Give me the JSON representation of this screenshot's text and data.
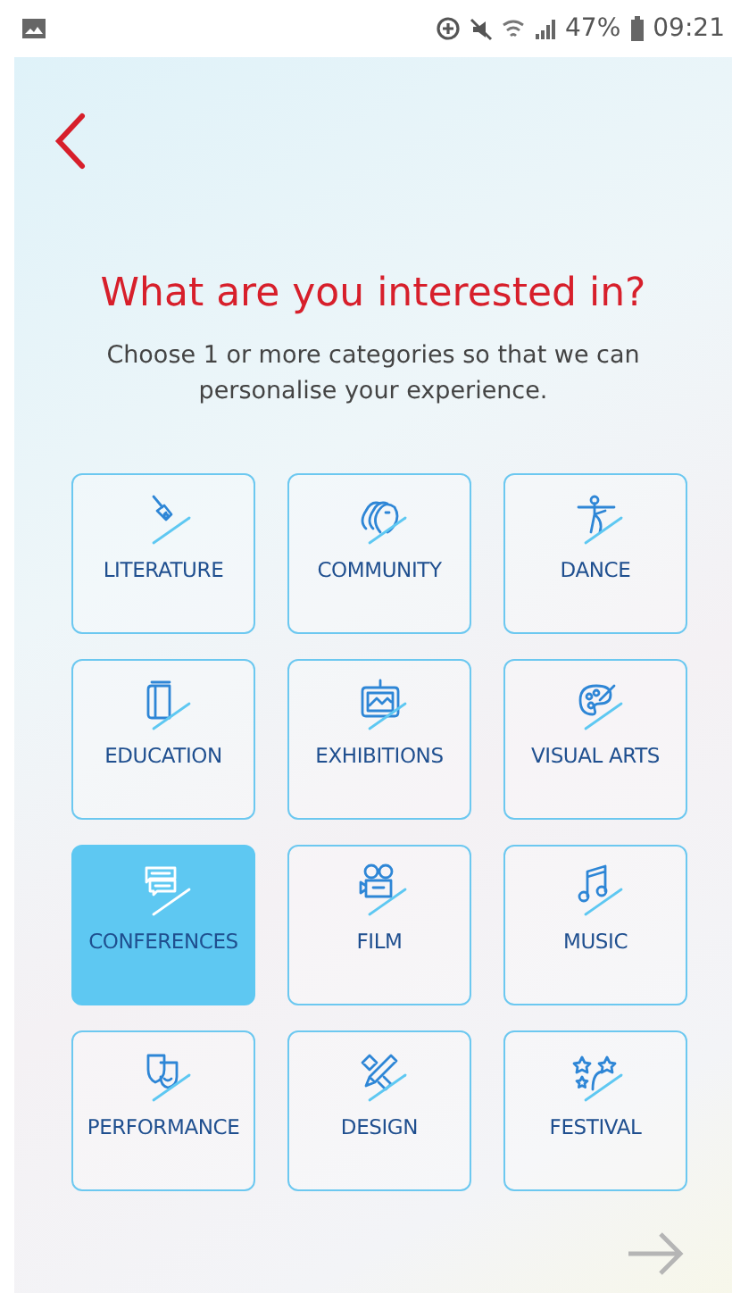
{
  "status_bar": {
    "battery": "47%",
    "time": "09:21"
  },
  "title": "What are you interested in?",
  "subtitle": "Choose 1 or more categories so that we can personalise your experience.",
  "categories": [
    {
      "label": "LITERATURE",
      "selected": false
    },
    {
      "label": "COMMUNITY",
      "selected": false
    },
    {
      "label": "DANCE",
      "selected": false
    },
    {
      "label": "EDUCATION",
      "selected": false
    },
    {
      "label": "EXHIBITIONS",
      "selected": false
    },
    {
      "label": "VISUAL ARTS",
      "selected": false
    },
    {
      "label": "CONFERENCES",
      "selected": true
    },
    {
      "label": "FILM",
      "selected": false
    },
    {
      "label": "MUSIC",
      "selected": false
    },
    {
      "label": "PERFORMANCE",
      "selected": false
    },
    {
      "label": "DESIGN",
      "selected": false
    },
    {
      "label": "FESTIVAL",
      "selected": false
    }
  ]
}
